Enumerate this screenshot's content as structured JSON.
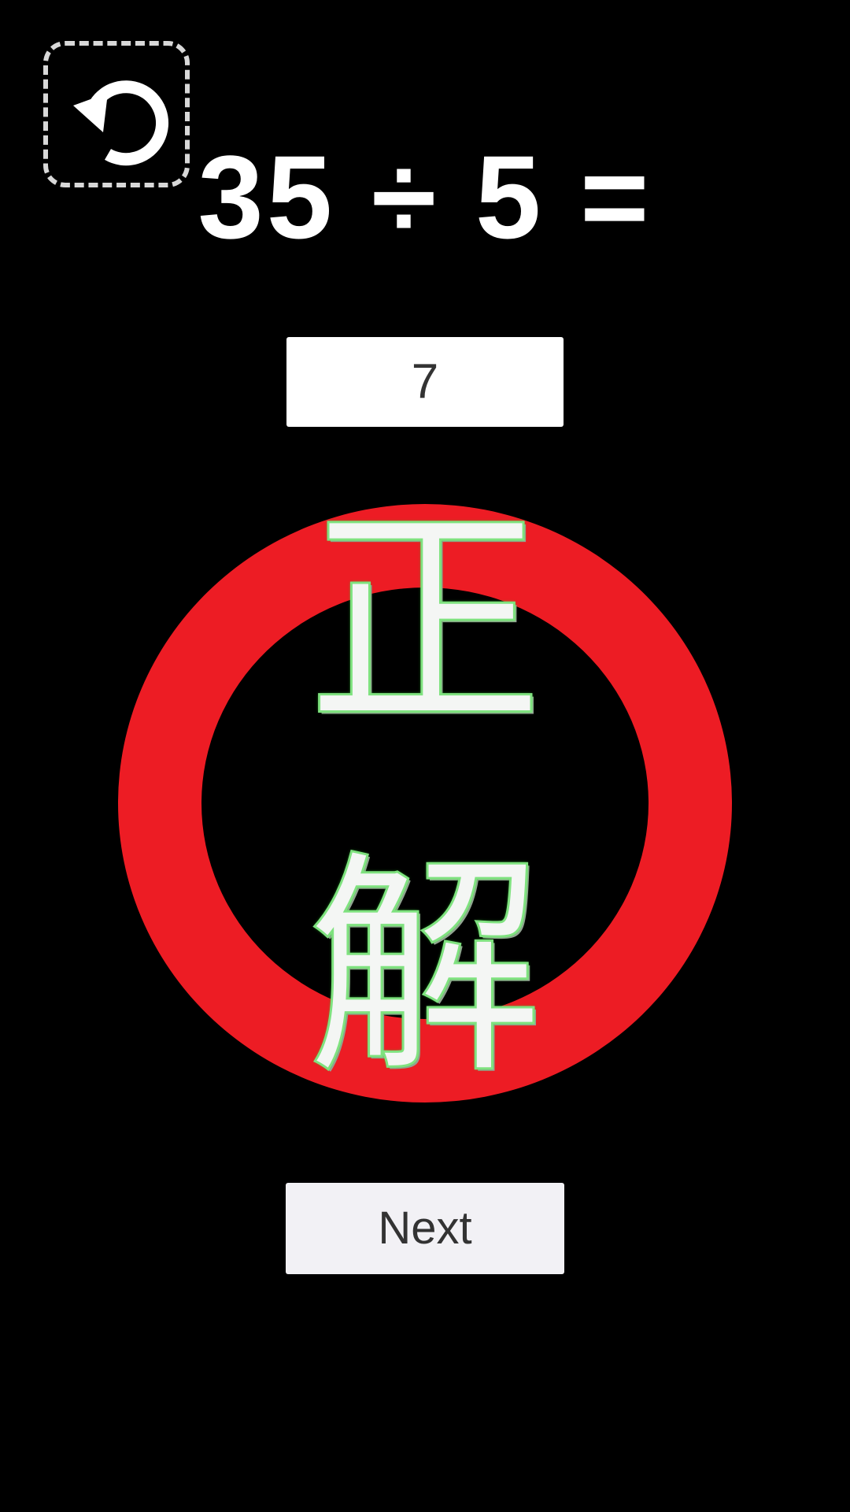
{
  "question": {
    "operand_a": "35",
    "operator": "÷",
    "operand_b": "5",
    "equals": "="
  },
  "answer": {
    "value": "7"
  },
  "result": {
    "char_1": "正",
    "char_2": "解",
    "ring_color": "#ed1c24"
  },
  "controls": {
    "undo_icon": "undo-arrow-icon",
    "next_label": "Next"
  }
}
